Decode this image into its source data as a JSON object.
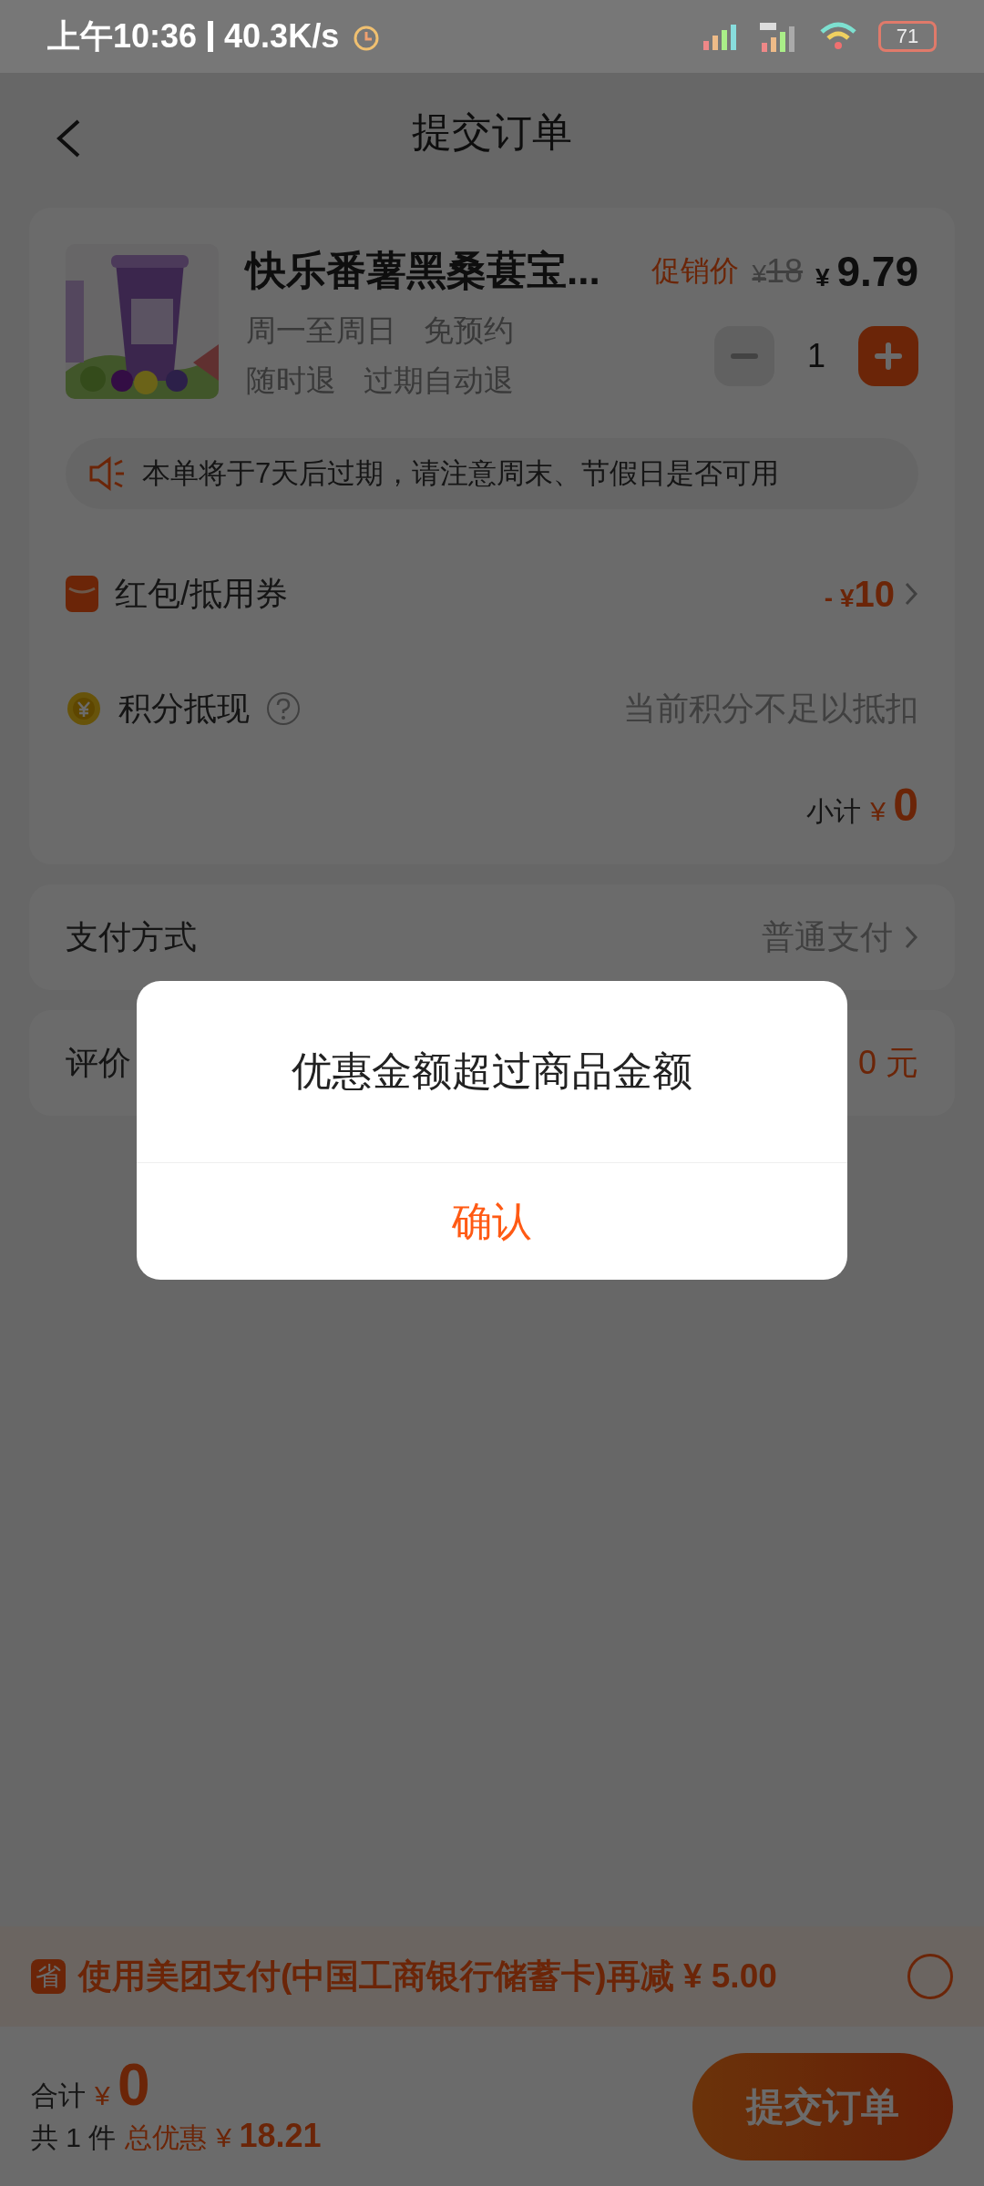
{
  "status_bar": {
    "time": "上午10:36",
    "speed": "40.3K/s",
    "battery": "71"
  },
  "header": {
    "title": "提交订单"
  },
  "product": {
    "name": "快乐番薯黑桑葚宝...",
    "promo_label": "促销价",
    "original_price": {
      "currency": "¥",
      "amount": "18"
    },
    "price": {
      "currency": "¥",
      "amount": "9.79"
    },
    "tags": [
      [
        "周一至周日",
        "免预约"
      ],
      [
        "随时退",
        "过期自动退"
      ]
    ],
    "quantity": "1",
    "decrement_disabled": true
  },
  "notice": "本单将于7天后过期，请注意周末、节假日是否可用",
  "discounts": [
    {
      "kind": "coupon",
      "label": "红包/抵用券",
      "sign": "-",
      "currency": "¥",
      "amount": "10"
    },
    {
      "kind": "points",
      "label": "积分抵现",
      "note": "当前积分不足以抵扣"
    }
  ],
  "subtotal": {
    "label": "小计",
    "currency": "¥",
    "amount": "0"
  },
  "payment": {
    "label": "支付方式",
    "value": "普通支付"
  },
  "review": {
    "label": "评价",
    "value": "0 元"
  },
  "promo_banner": {
    "badge": "省",
    "text": "使用美团支付(中国工商银行储蓄卡)再减",
    "currency": "¥",
    "amount": "5.00",
    "checked": false
  },
  "total": {
    "label": "合计",
    "currency": "¥",
    "amount": "0",
    "count": "共 1 件",
    "discount_label": "总优惠",
    "discount_currency": "¥",
    "discount_amount": "18.21"
  },
  "submit": "提交订单",
  "dialog": {
    "message": "优惠金额超过商品金额",
    "confirm": "确认"
  }
}
